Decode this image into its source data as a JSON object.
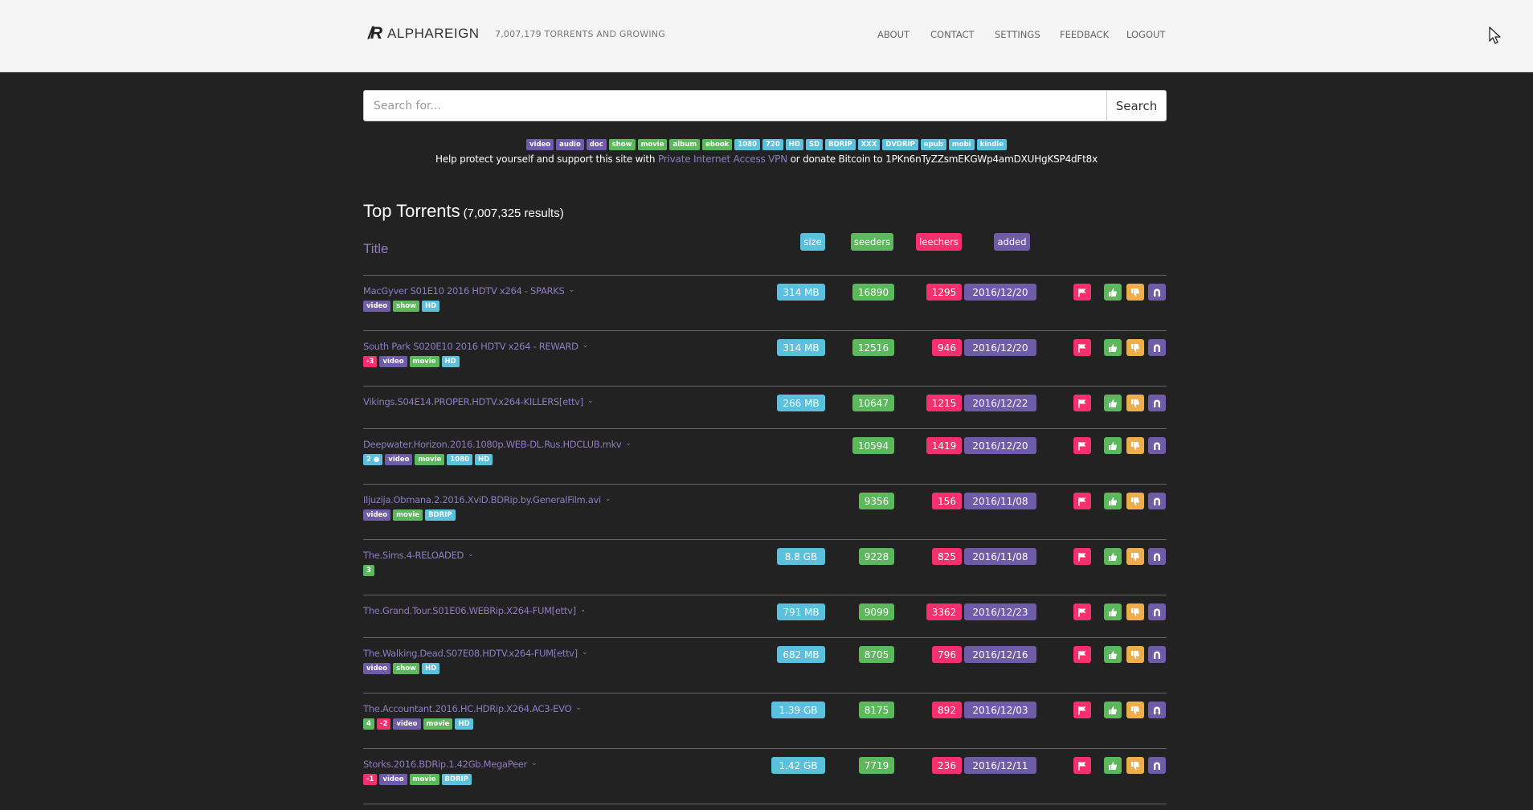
{
  "header": {
    "logo_mark": "/R",
    "brand": "ALPHAREIGN",
    "tagline": "7,007,179 TORRENTS AND GROWING",
    "nav": [
      "ABOUT",
      "CONTACT",
      "SETTINGS",
      "FEEDBACK",
      "LOGOUT"
    ]
  },
  "search": {
    "placeholder": "Search for...",
    "button": "Search"
  },
  "categories": [
    {
      "label": "video",
      "color": "purple"
    },
    {
      "label": "audio",
      "color": "purple"
    },
    {
      "label": "doc",
      "color": "purple"
    },
    {
      "label": "show",
      "color": "green"
    },
    {
      "label": "movie",
      "color": "green"
    },
    {
      "label": "album",
      "color": "green"
    },
    {
      "label": "ebook",
      "color": "green"
    },
    {
      "label": "1080",
      "color": "blue"
    },
    {
      "label": "720",
      "color": "blue"
    },
    {
      "label": "HD",
      "color": "blue"
    },
    {
      "label": "SD",
      "color": "blue"
    },
    {
      "label": "BDRIP",
      "color": "blue"
    },
    {
      "label": "XXX",
      "color": "blue"
    },
    {
      "label": "DVDRIP",
      "color": "blue"
    },
    {
      "label": "epub",
      "color": "blue"
    },
    {
      "label": "mobi",
      "color": "blue"
    },
    {
      "label": "kindle",
      "color": "blue"
    }
  ],
  "promo": {
    "before": "Help protect yourself and support this site with ",
    "link": "Private Internet Access VPN",
    "after": " or donate Bitcoin to 1PKn6nTyZZsmEKGWp4amDXUHgKSP4dFt8x"
  },
  "section": {
    "title": "Top Torrents",
    "count": "(7,007,325 results)"
  },
  "columns": {
    "title": "Title",
    "size": "size",
    "seeders": "seeders",
    "leechers": "leechers",
    "added": "added"
  },
  "colors": {
    "blue": "#5bc0de",
    "green": "#5cb85c",
    "red": "#f6306e",
    "purple": "#6e5ca8",
    "orange": "#f0ad4e",
    "link": "#8e7cc3"
  },
  "torrents": [
    {
      "title": "MacGyver S01E10 2016 HDTV x264 - SPARKS",
      "tags": [
        {
          "label": "video",
          "color": "purple"
        },
        {
          "label": "show",
          "color": "green"
        },
        {
          "label": "HD",
          "color": "blue"
        }
      ],
      "size": "314 MB",
      "seeders": "16890",
      "leechers": "1295",
      "added": "2016/12/20"
    },
    {
      "title": "South Park S020E10 2016 HDTV x264 - REWARD",
      "tags": [
        {
          "label": "-3",
          "color": "red"
        },
        {
          "label": "video",
          "color": "purple"
        },
        {
          "label": "movie",
          "color": "green"
        },
        {
          "label": "HD",
          "color": "blue"
        }
      ],
      "size": "314 MB",
      "seeders": "12516",
      "leechers": "946",
      "added": "2016/12/20"
    },
    {
      "title": "Vikings.S04E14.PROPER.HDTV.x264-KILLERS[ettv]",
      "tags": [],
      "size": "266 MB",
      "seeders": "10647",
      "leechers": "1215",
      "added": "2016/12/22"
    },
    {
      "title": "Deepwater.Horizon.2016.1080p.WEB-DL.Rus.HDCLUB.mkv",
      "tags": [
        {
          "label": "2 ●",
          "color": "blue"
        },
        {
          "label": "video",
          "color": "purple"
        },
        {
          "label": "movie",
          "color": "green"
        },
        {
          "label": "1080",
          "color": "blue"
        },
        {
          "label": "HD",
          "color": "blue"
        }
      ],
      "size": "",
      "seeders": "10594",
      "leechers": "1419",
      "added": "2016/12/20"
    },
    {
      "title": "Iljuzija.Obmana.2.2016.XviD.BDRip.by.GeneralFilm.avi",
      "tags": [
        {
          "label": "video",
          "color": "purple"
        },
        {
          "label": "movie",
          "color": "green"
        },
        {
          "label": "BDRIP",
          "color": "blue"
        }
      ],
      "size": "",
      "seeders": "9356",
      "leechers": "156",
      "added": "2016/11/08"
    },
    {
      "title": "The.Sims.4-RELOADED",
      "tags": [
        {
          "label": "3",
          "color": "green"
        }
      ],
      "size": "8.8 GB",
      "seeders": "9228",
      "leechers": "825",
      "added": "2016/11/08"
    },
    {
      "title": "The.Grand.Tour.S01E06.WEBRip.X264-FUM[ettv]",
      "tags": [],
      "size": "791 MB",
      "seeders": "9099",
      "leechers": "3362",
      "added": "2016/12/23"
    },
    {
      "title": "The.Walking.Dead.S07E08.HDTV.x264-FUM[ettv]",
      "tags": [
        {
          "label": "video",
          "color": "purple"
        },
        {
          "label": "show",
          "color": "green"
        },
        {
          "label": "HD",
          "color": "blue"
        }
      ],
      "size": "682 MB",
      "seeders": "8705",
      "leechers": "796",
      "added": "2016/12/16"
    },
    {
      "title": "The.Accountant.2016.HC.HDRip.X264.AC3-EVO",
      "tags": [
        {
          "label": "4",
          "color": "green"
        },
        {
          "label": "-2",
          "color": "red"
        },
        {
          "label": "video",
          "color": "purple"
        },
        {
          "label": "movie",
          "color": "green"
        },
        {
          "label": "HD",
          "color": "blue"
        }
      ],
      "size": "1.39 GB",
      "seeders": "8175",
      "leechers": "892",
      "added": "2016/12/03"
    },
    {
      "title": "Storks.2016.BDRip.1.42Gb.MegaPeer",
      "tags": [
        {
          "label": "-1",
          "color": "red"
        },
        {
          "label": "video",
          "color": "purple"
        },
        {
          "label": "movie",
          "color": "green"
        },
        {
          "label": "BDRIP",
          "color": "blue"
        }
      ],
      "size": "1.42 GB",
      "seeders": "7719",
      "leechers": "236",
      "added": "2016/12/11"
    }
  ]
}
